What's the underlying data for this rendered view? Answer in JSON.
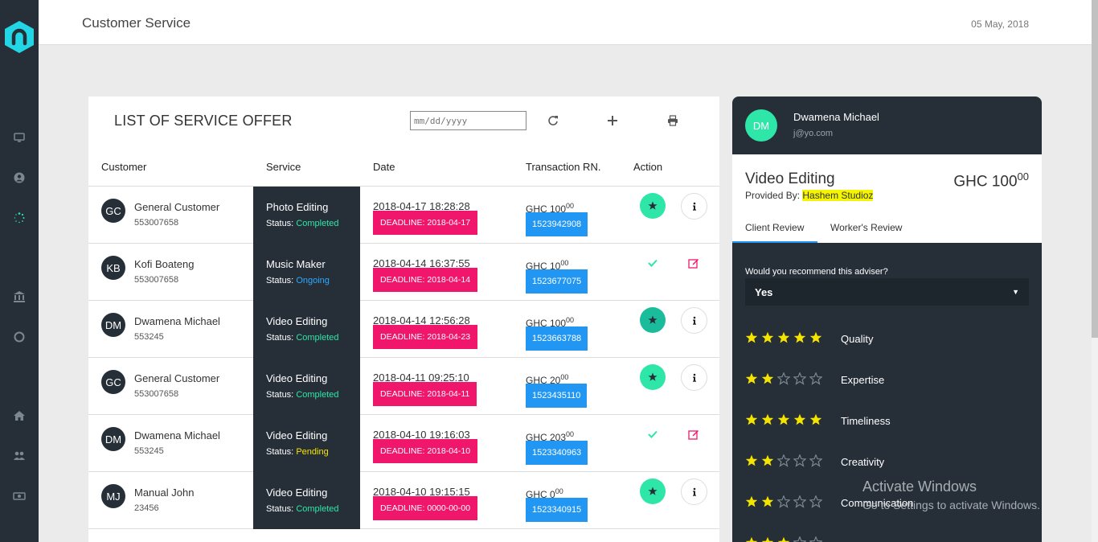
{
  "header": {
    "title": "Customer Service",
    "date": "05 May, 2018"
  },
  "sidebar": {
    "icons": [
      "monitor-icon",
      "user-circle-icon",
      "spinner-icon",
      "bank-icon",
      "circle-icon",
      "home-icon",
      "users-icon",
      "money-icon"
    ]
  },
  "list": {
    "title": "LIST OF SERVICE OFFER",
    "date_placeholder": "mm/dd/yyyy",
    "columns": [
      "Customer",
      "Service",
      "Date",
      "Transaction RN.",
      "Action"
    ],
    "status_prefix": "Status:",
    "rows": [
      {
        "initials": "GC",
        "name": "General Customer",
        "id": "553007658",
        "service": "Photo Editing",
        "status": "Completed",
        "date": "2018-04-17 18:28:28",
        "deadline": "DEADLINE: 2018-04-17",
        "amount": "GHC 100",
        "cents": "00",
        "trn": "1523942908",
        "action": "rate"
      },
      {
        "initials": "KB",
        "name": "Kofi Boateng",
        "id": "553007658",
        "service": "Music Maker",
        "status": "Ongoing",
        "date": "2018-04-14 16:37:55",
        "deadline": "DEADLINE: 2018-04-14",
        "amount": "GHC 10",
        "cents": "00",
        "trn": "1523677075",
        "action": "edit"
      },
      {
        "initials": "DM",
        "name": "Dwamena Michael",
        "id": "553245",
        "service": "Video Editing",
        "status": "Completed",
        "date": "2018-04-14 12:56:28",
        "deadline": "DEADLINE: 2018-04-23",
        "amount": "GHC 100",
        "cents": "00",
        "trn": "1523663788",
        "action": "rate-selected"
      },
      {
        "initials": "GC",
        "name": "General Customer",
        "id": "553007658",
        "service": "Video Editing",
        "status": "Completed",
        "date": "2018-04-11 09:25:10",
        "deadline": "DEADLINE: 2018-04-11",
        "amount": "GHC 20",
        "cents": "00",
        "trn": "1523435110",
        "action": "rate"
      },
      {
        "initials": "DM",
        "name": "Dwamena Michael",
        "id": "553245",
        "service": "Video Editing",
        "status": "Pending",
        "date": "2018-04-10 19:16:03",
        "deadline": "DEADLINE: 2018-04-10",
        "amount": "GHC 203",
        "cents": "00",
        "trn": "1523340963",
        "action": "edit"
      },
      {
        "initials": "MJ",
        "name": "Manual John",
        "id": "23456",
        "service": "Video Editing",
        "status": "Completed",
        "date": "2018-04-10 19:15:15",
        "deadline": "DEADLINE: 0000-00-00",
        "amount": "GHC 0",
        "cents": "00",
        "trn": "1523340915",
        "action": "rate"
      }
    ]
  },
  "panel": {
    "initials": "DM",
    "name": "Dwamena Michael",
    "email": "j@yo.com",
    "service": "Video Editing",
    "provided_label": "Provided By:",
    "provider": "Hashem Studioz",
    "price": "GHC 100",
    "price_cents": "00",
    "tabs": [
      "Client Review",
      "Worker's Review"
    ],
    "question": "Would you recommend this adviser?",
    "answer": "Yes",
    "ratings": [
      {
        "label": "Quality",
        "stars": 5
      },
      {
        "label": "Expertise",
        "stars": 2
      },
      {
        "label": "Timeliness",
        "stars": 5
      },
      {
        "label": "Creativity",
        "stars": 2
      },
      {
        "label": "Communication",
        "stars": 2
      },
      {
        "label": "",
        "stars": 3
      }
    ]
  },
  "watermark": {
    "line1": "Activate Windows",
    "line2": "Go to Settings to activate Windows."
  },
  "colors": {
    "sidebar": "#262f38",
    "accent": "#2ee6a8",
    "deadline": "#f0166c",
    "transaction": "#2196f3",
    "star": "#f5e400"
  }
}
